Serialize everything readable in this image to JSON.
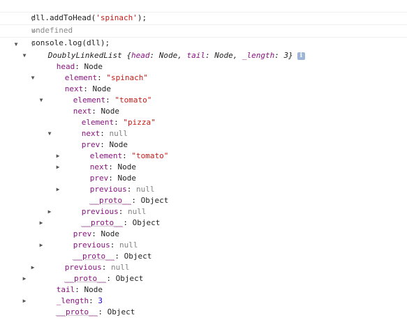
{
  "console": {
    "cmd1": {
      "fn": "dll.addToHead(",
      "arg": "'spinach'",
      "end": ");"
    },
    "result1": "undefined",
    "cmd2": "console.log(dll);"
  },
  "icons": {
    "input": "chevron-right-icon",
    "result": "return-arrow-icon",
    "expanded": "triangle-down-icon",
    "collapsed": "triangle-right-icon",
    "info": "info-icon"
  },
  "colors": {
    "key": "#881280",
    "string": "#c41a16",
    "null": "#808080",
    "number": "#1c00cf"
  },
  "tree": {
    "summary": {
      "class": "DoublyLinkedList",
      "open": " {",
      "k1": "head",
      "v1": ": Node, ",
      "k2": "tail",
      "v2": ": Node, ",
      "k3": "_length",
      "v3": ": 3}",
      "info": "i"
    },
    "rows": [
      {
        "key": "head",
        "sep": ": ",
        "val": "Node",
        "type": "obj"
      },
      {
        "key": "element",
        "sep": ": ",
        "val": "\"spinach\"",
        "type": "str"
      },
      {
        "key": "next",
        "sep": ": ",
        "val": "Node",
        "type": "obj"
      },
      {
        "key": "element",
        "sep": ": ",
        "val": "\"tomato\"",
        "type": "str"
      },
      {
        "key": "next",
        "sep": ": ",
        "val": "Node",
        "type": "obj"
      },
      {
        "key": "element",
        "sep": ": ",
        "val": "\"pizza\"",
        "type": "str"
      },
      {
        "key": "next",
        "sep": ": ",
        "val": "null",
        "type": "null"
      },
      {
        "key": "prev",
        "sep": ": ",
        "val": "Node",
        "type": "obj"
      },
      {
        "key": "element",
        "sep": ": ",
        "val": "\"tomato\"",
        "type": "str"
      },
      {
        "key": "next",
        "sep": ": ",
        "val": "Node",
        "type": "obj"
      },
      {
        "key": "prev",
        "sep": ": ",
        "val": "Node",
        "type": "obj"
      },
      {
        "key": "previous",
        "sep": ": ",
        "val": "null",
        "type": "null"
      },
      {
        "key": "__proto__",
        "sep": ": ",
        "val": "Object",
        "type": "obj"
      },
      {
        "key": "previous",
        "sep": ": ",
        "val": "null",
        "type": "null"
      },
      {
        "key": "__proto__",
        "sep": ": ",
        "val": "Object",
        "type": "obj"
      },
      {
        "key": "prev",
        "sep": ": ",
        "val": "Node",
        "type": "obj"
      },
      {
        "key": "previous",
        "sep": ": ",
        "val": "null",
        "type": "null"
      },
      {
        "key": "__proto__",
        "sep": ": ",
        "val": "Object",
        "type": "obj"
      },
      {
        "key": "previous",
        "sep": ": ",
        "val": "null",
        "type": "null"
      },
      {
        "key": "__proto__",
        "sep": ": ",
        "val": "Object",
        "type": "obj"
      },
      {
        "key": "tail",
        "sep": ": ",
        "val": "Node",
        "type": "obj"
      },
      {
        "key": "_length",
        "sep": ": ",
        "val": "3",
        "type": "num"
      },
      {
        "key": "__proto__",
        "sep": ": ",
        "val": "Object",
        "type": "obj"
      }
    ]
  }
}
